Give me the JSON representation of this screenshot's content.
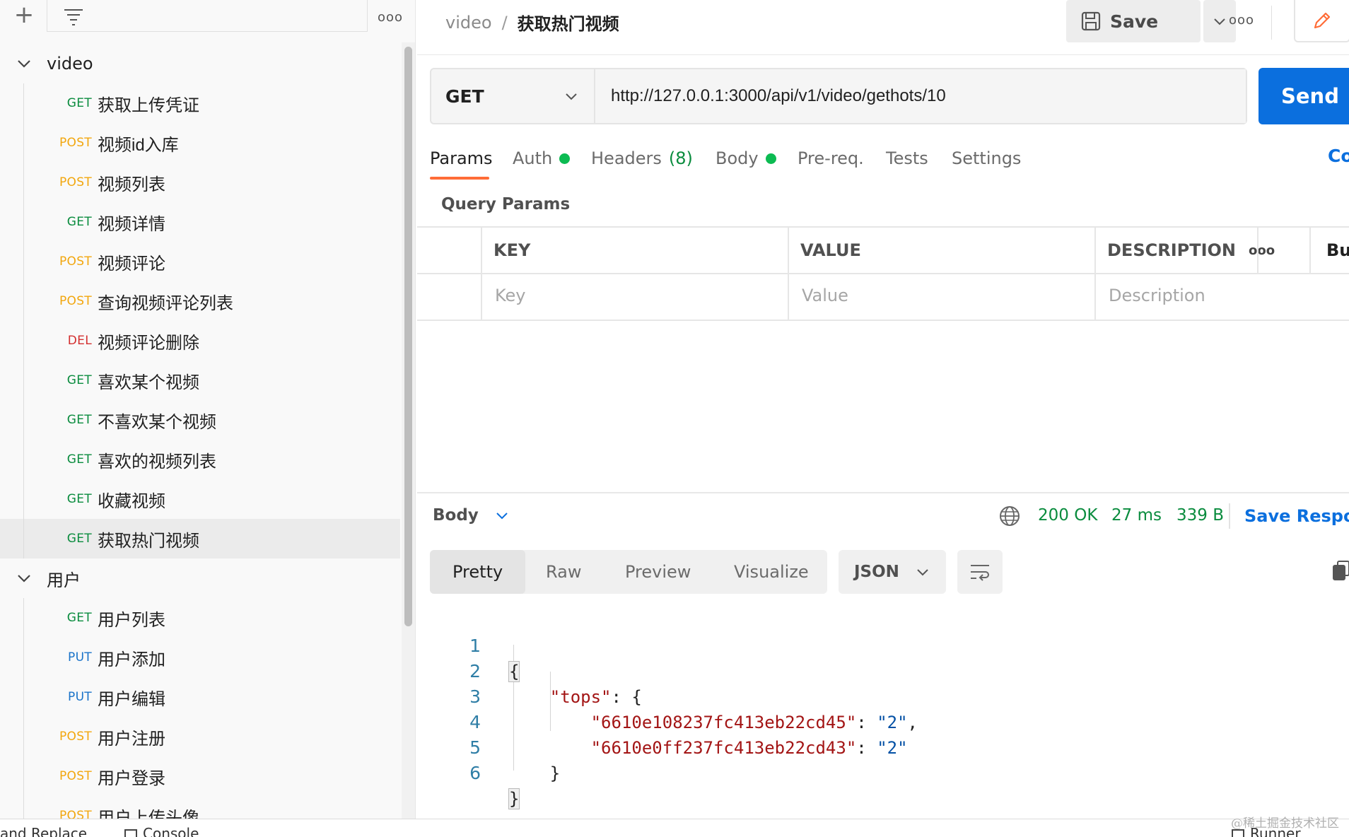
{
  "sidebar": {
    "more_icon": "ooo",
    "folders": [
      {
        "label": "video"
      },
      {
        "label": "用户"
      }
    ],
    "video_requests": [
      {
        "method": "GET",
        "label": "获取上传凭证",
        "color": "#0a8c3e"
      },
      {
        "method": "POST",
        "label": "视频id入库",
        "color": "#f2a60d"
      },
      {
        "method": "POST",
        "label": "视频列表",
        "color": "#f2a60d"
      },
      {
        "method": "GET",
        "label": "视频详情",
        "color": "#0a8c3e"
      },
      {
        "method": "POST",
        "label": "视频评论",
        "color": "#f2a60d"
      },
      {
        "method": "POST",
        "label": "查询视频评论列表",
        "color": "#f2a60d"
      },
      {
        "method": "DEL",
        "label": "视频评论删除",
        "color": "#d32f2f"
      },
      {
        "method": "GET",
        "label": "喜欢某个视频",
        "color": "#0a8c3e"
      },
      {
        "method": "GET",
        "label": "不喜欢某个视频",
        "color": "#0a8c3e"
      },
      {
        "method": "GET",
        "label": "喜欢的视频列表",
        "color": "#0a8c3e"
      },
      {
        "method": "GET",
        "label": "收藏视频",
        "color": "#0a8c3e"
      },
      {
        "method": "GET",
        "label": "获取热门视频",
        "color": "#0a8c3e"
      }
    ],
    "user_requests": [
      {
        "method": "GET",
        "label": "用户列表",
        "color": "#0a8c3e"
      },
      {
        "method": "PUT",
        "label": "用户添加",
        "color": "#1a73c9"
      },
      {
        "method": "PUT",
        "label": "用户编辑",
        "color": "#1a73c9"
      },
      {
        "method": "POST",
        "label": "用户注册",
        "color": "#f2a60d"
      },
      {
        "method": "POST",
        "label": "用户登录",
        "color": "#f2a60d"
      },
      {
        "method": "POST",
        "label": "用户上传头像",
        "color": "#f2a60d"
      }
    ]
  },
  "statusbar": {
    "find_replace": "and Replace",
    "console": "Console",
    "runner": "Runner"
  },
  "watermark": "@稀土掘金技术社区",
  "header": {
    "breadcrumb_parent": "video",
    "breadcrumb_sep": "/",
    "breadcrumb_current": "获取热门视频",
    "save_label": "Save",
    "more_icon": "ooo"
  },
  "request": {
    "method": "GET",
    "url": "http://127.0.0.1:3000/api/v1/video/gethots/10",
    "send_label": "Send"
  },
  "tabs": {
    "params": "Params",
    "auth": "Auth",
    "headers": "Headers",
    "headers_count": "(8)",
    "body": "Body",
    "prereq": "Pre-req.",
    "tests": "Tests",
    "settings": "Settings",
    "cookies": "Co"
  },
  "query_params": {
    "title": "Query Params",
    "col_key": "KEY",
    "col_value": "VALUE",
    "col_description": "DESCRIPTION",
    "more_icon": "ooo",
    "bulk": "Bul",
    "placeholder_key": "Key",
    "placeholder_value": "Value",
    "placeholder_description": "Description"
  },
  "response": {
    "body_label": "Body",
    "status": "200 OK",
    "time": "27 ms",
    "size": "339 B",
    "save_response": "Save Respon",
    "view_tabs": [
      "Pretty",
      "Raw",
      "Preview",
      "Visualize"
    ],
    "format": "JSON",
    "code_lines": [
      {
        "num": "1"
      },
      {
        "num": "2",
        "key": "\"tops\""
      },
      {
        "num": "3",
        "key": "\"6610e108237fc413eb22cd45\"",
        "val": "\"2\""
      },
      {
        "num": "4",
        "key": "\"6610e0ff237fc413eb22cd43\"",
        "val": "\"2\""
      },
      {
        "num": "5"
      },
      {
        "num": "6"
      }
    ]
  },
  "colors": {
    "accent_orange": "#ff6c37",
    "send_blue": "#0b6fde",
    "status_green": "#0a8c3e"
  }
}
